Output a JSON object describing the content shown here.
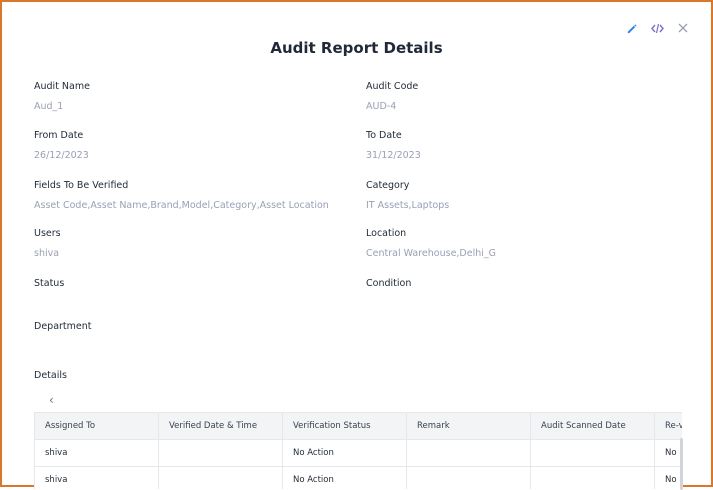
{
  "modal": {
    "title": "Audit Report Details",
    "actions": [
      {
        "icon": "pencil-icon"
      },
      {
        "icon": "code-icon"
      },
      {
        "icon": "close-icon"
      }
    ]
  },
  "fields": {
    "audit_name": {
      "label": "Audit Name",
      "value": "Aud_1"
    },
    "audit_code": {
      "label": "Audit Code",
      "value": "AUD-4"
    },
    "from_date": {
      "label": "From Date",
      "value": "26/12/2023"
    },
    "to_date": {
      "label": "To Date",
      "value": "31/12/2023"
    },
    "fields_to_verify": {
      "label": "Fields To Be Verified",
      "value": "Asset Code,Asset Name,Brand,Model,Category,Asset Location"
    },
    "category": {
      "label": "Category",
      "value": "IT Assets,Laptops"
    },
    "users": {
      "label": "Users",
      "value": "shiva"
    },
    "location": {
      "label": "Location",
      "value": "Central Warehouse,Delhi_G"
    },
    "status": {
      "label": "Status",
      "value": ""
    },
    "condition": {
      "label": "Condition",
      "value": ""
    },
    "department": {
      "label": "Department",
      "value": ""
    }
  },
  "details": {
    "label": "Details",
    "scroll_left": "‹",
    "columns": [
      "Assigned To",
      "Verified Date & Time",
      "Verification Status",
      "Remark",
      "Audit Scanned Date",
      "Re-v"
    ],
    "rows": [
      [
        "shiva",
        "",
        "No Action",
        "",
        "",
        "No"
      ],
      [
        "shiva",
        "",
        "No Action",
        "",
        "",
        "No"
      ]
    ]
  },
  "colors": {
    "accent": "#2f80ed",
    "frame": "#d9772b",
    "muted": "#9aa0b4"
  }
}
